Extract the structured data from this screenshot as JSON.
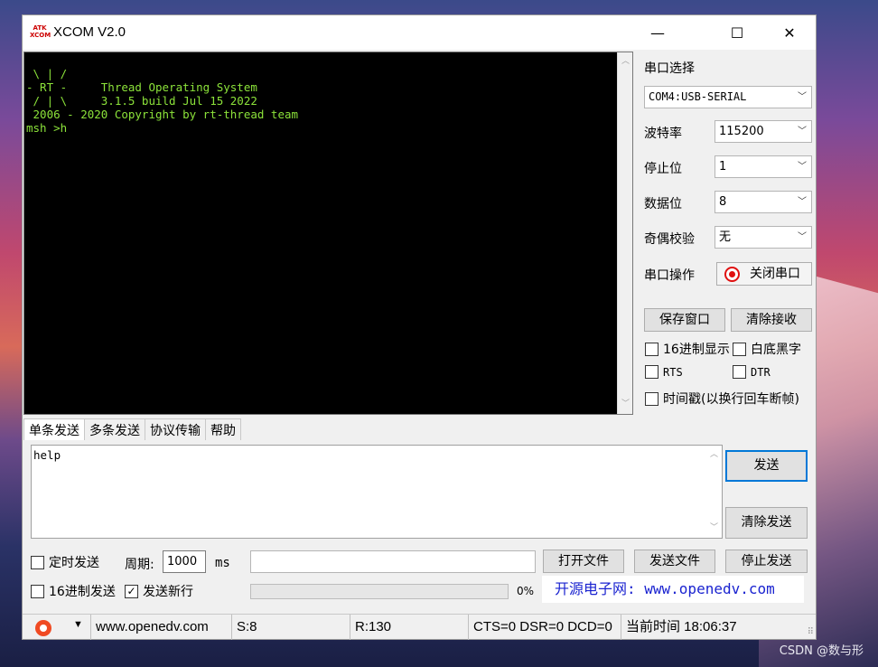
{
  "window": {
    "title": "XCOM V2.0",
    "logo_text": "ATK\nXCOM",
    "minimize": "—",
    "maximize": "☐",
    "close": "✕"
  },
  "terminal": {
    "lines": " \\ | /\n- RT -     Thread Operating System\n / | \\     3.1.5 build Jul 15 2022\n 2006 - 2020 Copyright by rt-thread team\nmsh >h"
  },
  "settings": {
    "port_label": "串口选择",
    "port_value": "COM4:USB-SERIAL",
    "baud_label": "波特率",
    "baud_value": "115200",
    "stop_label": "停止位",
    "stop_value": "1",
    "data_label": "数据位",
    "data_value": "8",
    "parity_label": "奇偶校验",
    "parity_value": "无",
    "op_label": "串口操作",
    "op_button": "关闭串口",
    "save_window": "保存窗口",
    "clear_receive": "清除接收",
    "hex_display": "16进制显示",
    "white_black": "白底黑字",
    "rts": "RTS",
    "dtr": "DTR",
    "timestamp": "时间戳(以换行回车断帧)"
  },
  "tabs": [
    "单条发送",
    "多条发送",
    "协议传输",
    "帮助"
  ],
  "send": {
    "text": "help",
    "send_button": "发送",
    "clear_send": "清除发送",
    "timed_send": "定时发送",
    "period_label": "周期:",
    "period_value": "1000",
    "period_unit": "ms",
    "open_file": "打开文件",
    "send_file": "发送文件",
    "stop_send": "停止发送",
    "hex_send": "16进制发送",
    "send_newline": "发送新行",
    "newline_checked": true,
    "progress_label": "0%",
    "progress": 0,
    "banner": "开源电子网: www.openedv.com"
  },
  "status": {
    "website": "www.openedv.com",
    "sent": "S:8",
    "received": "R:130",
    "lines": "CTS=0 DSR=0 DCD=0",
    "time": "当前时间 18:06:37"
  },
  "watermark": "CSDN @数与形"
}
